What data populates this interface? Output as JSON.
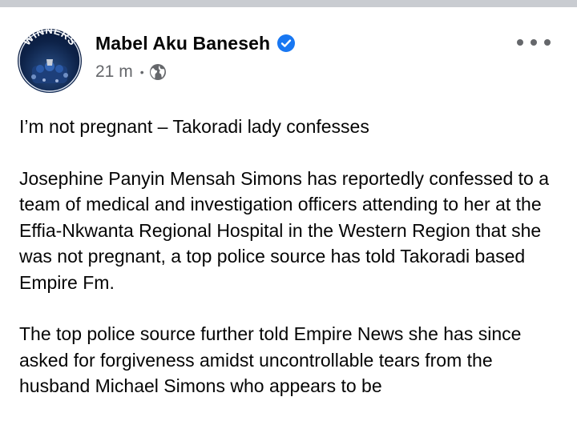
{
  "post": {
    "author": "Mabel Aku Baneseh",
    "time": "21 m",
    "separator": "•",
    "avatar_text": "WINNERS",
    "icons": {
      "verified": "verified-badge-icon",
      "privacy": "globe-icon",
      "more": "more-options-icon"
    },
    "colors": {
      "verified_blue": "#1877f2",
      "meta_gray": "#65676b",
      "text": "#050505"
    },
    "paragraphs": [
      "I’m not pregnant – Takoradi lady confesses",
      "Josephine Panyin Mensah Simons has reportedly confessed to a team of medical and investigation officers attending to her at the Effia-Nkwanta Regional Hospital in the Western Region that she was not pregnant, a top police source has told Takoradi based Empire Fm.",
      "The top police source further told Empire News she has since asked for forgiveness amidst uncontrollable tears from the husband Michael Simons who appears to be"
    ]
  }
}
